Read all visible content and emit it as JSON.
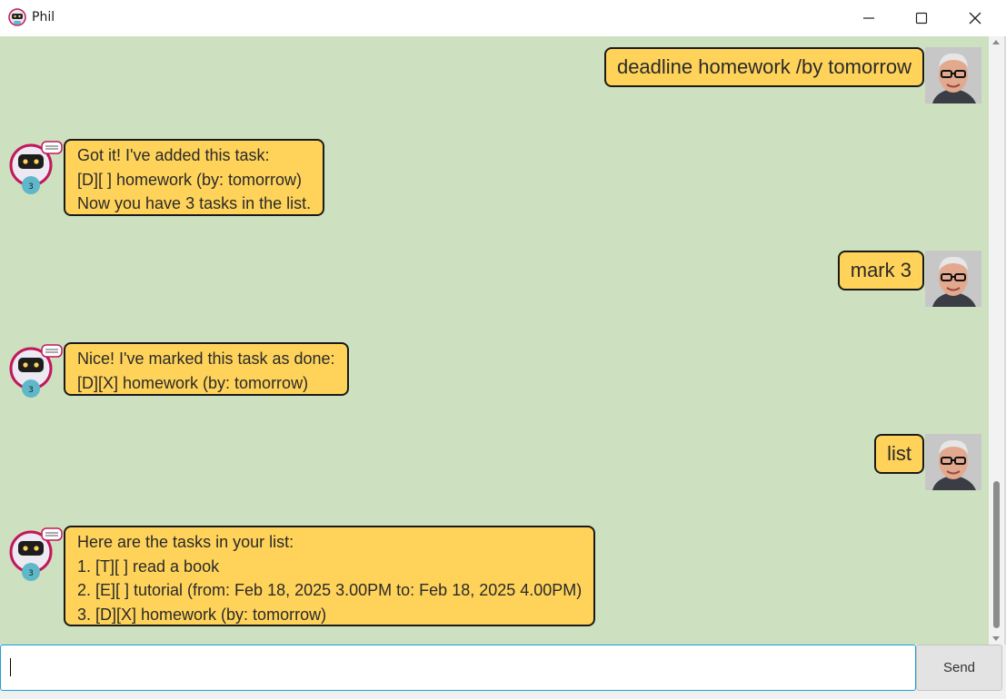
{
  "window": {
    "title": "Phil",
    "controls": {
      "minimize": "minimize-icon",
      "maximize": "maximize-icon",
      "close": "close-icon"
    }
  },
  "colors": {
    "chat_bg": "#cde0bf",
    "bubble": "#ffd35a",
    "bubble_border": "#1a1a1a",
    "input_border": "#1f9ed6"
  },
  "messages": [
    {
      "from": "user",
      "lines": [
        "deadline homework /by tomorrow"
      ]
    },
    {
      "from": "bot",
      "lines": [
        "Got it! I've added this task:",
        "[D][ ] homework (by: tomorrow)",
        "Now you have 3 tasks in the list."
      ]
    },
    {
      "from": "user",
      "lines": [
        "mark 3"
      ]
    },
    {
      "from": "bot",
      "lines": [
        "Nice! I've marked this task as done:",
        "[D][X] homework (by: tomorrow)"
      ]
    },
    {
      "from": "user",
      "lines": [
        "list"
      ]
    },
    {
      "from": "bot",
      "lines": [
        "Here are the tasks in your list:",
        "1. [T][ ] read a book",
        "2. [E][ ] tutorial (from: Feb 18, 2025 3.00PM to: Feb 18, 2025 4.00PM)",
        "3. [D][X] homework (by: tomorrow)"
      ]
    }
  ],
  "input": {
    "value": "",
    "placeholder": ""
  },
  "send_button": {
    "label": "Send"
  }
}
